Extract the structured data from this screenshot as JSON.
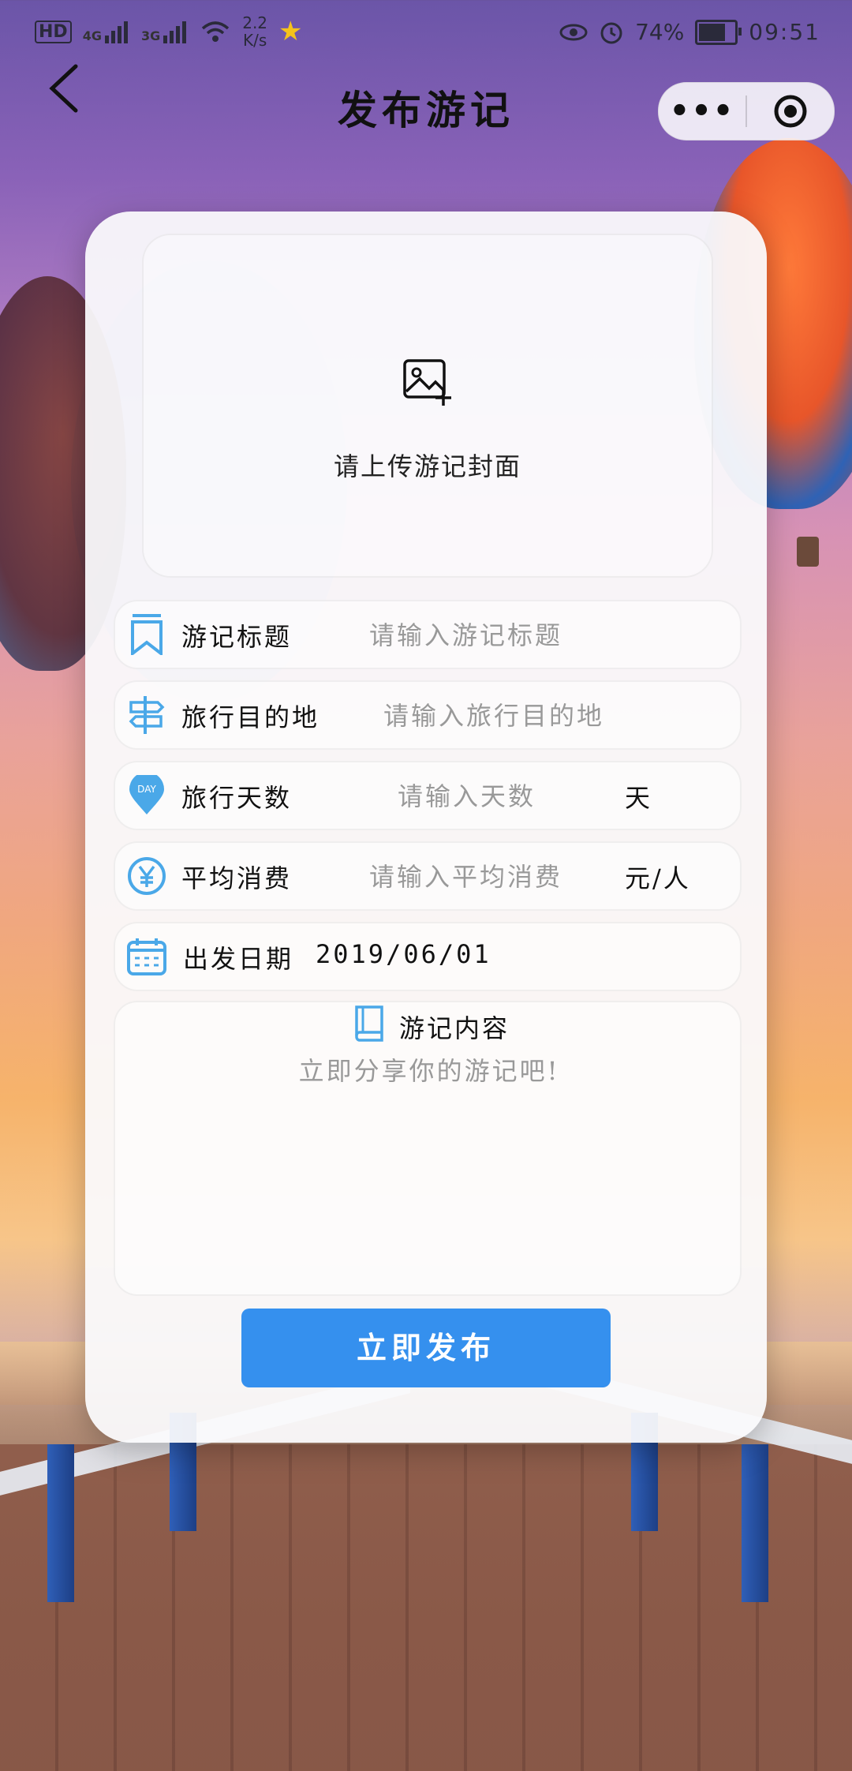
{
  "status_bar": {
    "hd_label": "HD",
    "sim1_label": "4G",
    "sim2_label": "3G",
    "net_speed_value": "2.2",
    "net_speed_unit": "K/s",
    "battery_percent": "74%",
    "battery_level": 0.74,
    "time": "09:51"
  },
  "nav": {
    "title": "发布游记",
    "menu_glyph": "•••"
  },
  "cover": {
    "prompt": "请上传游记封面"
  },
  "form": {
    "title": {
      "label": "游记标题",
      "placeholder": "请输入游记标题",
      "value": ""
    },
    "destination": {
      "label": "旅行目的地",
      "placeholder": "请输入旅行目的地",
      "value": ""
    },
    "days": {
      "label": "旅行天数",
      "placeholder": "请输入天数",
      "value": "",
      "unit": "天",
      "icon_text": "DAY"
    },
    "cost": {
      "label": "平均消费",
      "placeholder": "请输入平均消费",
      "value": "",
      "unit": "元/人"
    },
    "date": {
      "label": "出发日期",
      "value": "2019/06/01"
    },
    "content": {
      "label": "游记内容",
      "placeholder": "立即分享你的游记吧!",
      "value": ""
    }
  },
  "publish_button": "立即发布",
  "colors": {
    "accent": "#3590ee",
    "icon_blue": "#4aa8e8"
  }
}
